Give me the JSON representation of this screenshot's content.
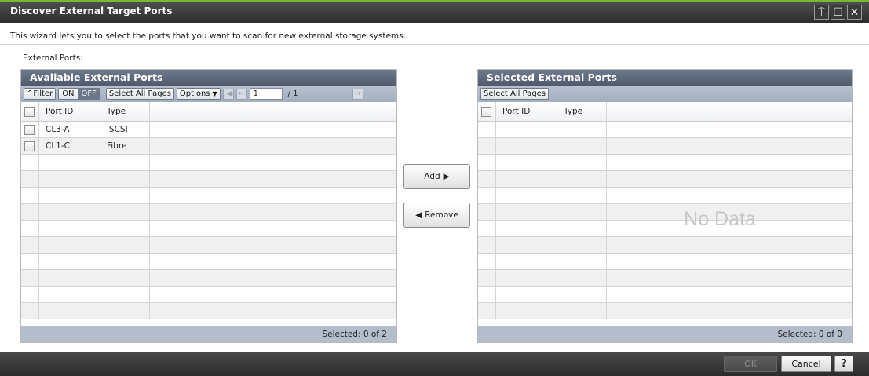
{
  "window": {
    "title": "Discover External Target Ports",
    "buttons": [
      "pin",
      "maximize",
      "close"
    ]
  },
  "description": "This wizard lets you to select the ports that you want to scan for new external storage systems.",
  "section_label": "External Ports:",
  "available": {
    "header": "Available External Ports",
    "toolbar": {
      "filter_label": "Filter",
      "on_label": "ON",
      "off_label": "OFF",
      "select_all_label": "Select All Pages",
      "options_label": "Options",
      "page_value": "1",
      "page_total": "/ 1"
    },
    "columns": [
      "Port ID",
      "Type"
    ],
    "rows": [
      {
        "port_id": "CL3-A",
        "type": "iSCSI"
      },
      {
        "port_id": "CL1-C",
        "type": "Fibre"
      }
    ],
    "footer": "Selected:  0   of  2"
  },
  "selected": {
    "header": "Selected External Ports",
    "toolbar": {
      "select_all_label": "Select All Pages"
    },
    "columns": [
      "Port ID",
      "Type"
    ],
    "empty_text": "No Data",
    "footer": "Selected:  0   of  0"
  },
  "actions": {
    "add_label": "Add",
    "remove_label": "Remove"
  },
  "footer_buttons": {
    "ok_label": "OK",
    "cancel_label": "Cancel",
    "help_label": "?"
  },
  "colors": {
    "title_accent": "#7ab92f",
    "panel_header": "#5a6678",
    "toolbar": "#a9b4c4",
    "footer": "#b3bdcb"
  }
}
